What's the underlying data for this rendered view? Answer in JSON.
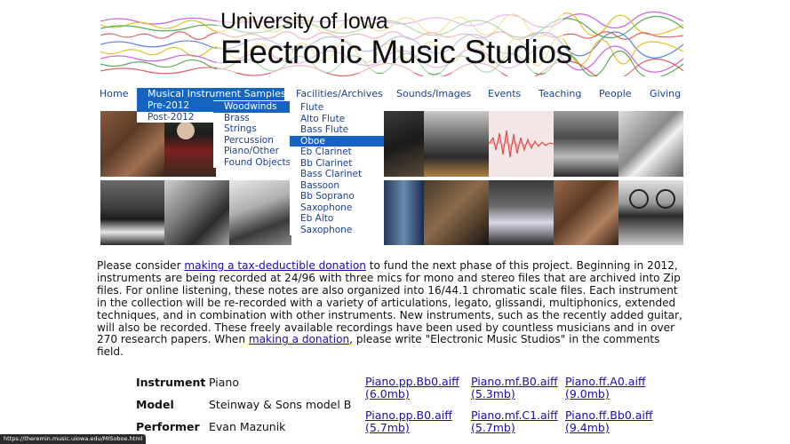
{
  "header": {
    "title_line1": "University of Iowa",
    "title_line2": "Electronic Music Studios"
  },
  "nav": {
    "items": [
      {
        "label": "Home"
      },
      {
        "label": "Musical Instrument Samples"
      },
      {
        "label": "Facilities/Archives"
      },
      {
        "label": "Sounds/Images"
      },
      {
        "label": "Events"
      },
      {
        "label": "Teaching"
      },
      {
        "label": "People"
      },
      {
        "label": "Giving"
      }
    ]
  },
  "menus": {
    "era": [
      "Pre-2012",
      "Post-2012"
    ],
    "family": [
      "Woodwinds",
      "Brass",
      "Strings",
      "Percussion",
      "Piano/Other",
      "Found Objects"
    ],
    "woodwinds": [
      "Flute",
      "Alto Flute",
      "Bass Flute",
      "Oboe",
      "Eb Clarinet",
      "Bb Clarinet",
      "Bass Clarinet",
      "Bassoon",
      "Bb Soprano",
      "Saxophone",
      "Eb Alto",
      "Saxophone"
    ]
  },
  "intro": {
    "pre1": "Please consider ",
    "link1": "making a tax-deductible donation",
    "mid": " to fund the next phase of this project. Beginning in 2012, instruments are being recorded at 24/96 with three mics for mono and stereo files that are archived into Zip files. For online listening, these notes are also organized into 16/44.1 chromatic scale files. Each instrument in the collection will be re-recorded with a variety of articulations, legato, glissandi, multiphonics, extended techniques, and in combination with other instruments. New instruments, such as the recently added guitar, will also be recorded. These freely available recordings have been used by countless musicians and in over 270 research papers. When ",
    "link2": "making a donation",
    "post": ", please write \"Electronic Music Studios\" in the comments field."
  },
  "details": {
    "instrument_label": "Instrument",
    "instrument_value": "Piano",
    "model_label": "Model",
    "model_value": "Steinway & Sons model B",
    "performer_label": "Performer",
    "performer_value": "Evan Mazunik"
  },
  "files": [
    {
      "name": "Piano.pp.Bb0.aiff",
      "size": "(6.0mb)"
    },
    {
      "name": "Piano.mf.B0.aiff",
      "size": "(5.3mb)"
    },
    {
      "name": "Piano.ff.A0.aiff",
      "size": "(9.0mb)"
    },
    {
      "name": "Piano.pp.B0.aiff",
      "size": "(5.7mb)"
    },
    {
      "name": "Piano.mf.C1.aiff",
      "size": "(5.7mb)"
    },
    {
      "name": "Piano.ff.Bb0.aiff",
      "size": "(9.4mb)"
    }
  ],
  "status": {
    "url": "https://theremin.music.uiowa.edu/MISoboe.html"
  },
  "colors": {
    "nav_link": "#1c3f94",
    "nav_active": "#1565c0",
    "link": "#1a0dab"
  }
}
